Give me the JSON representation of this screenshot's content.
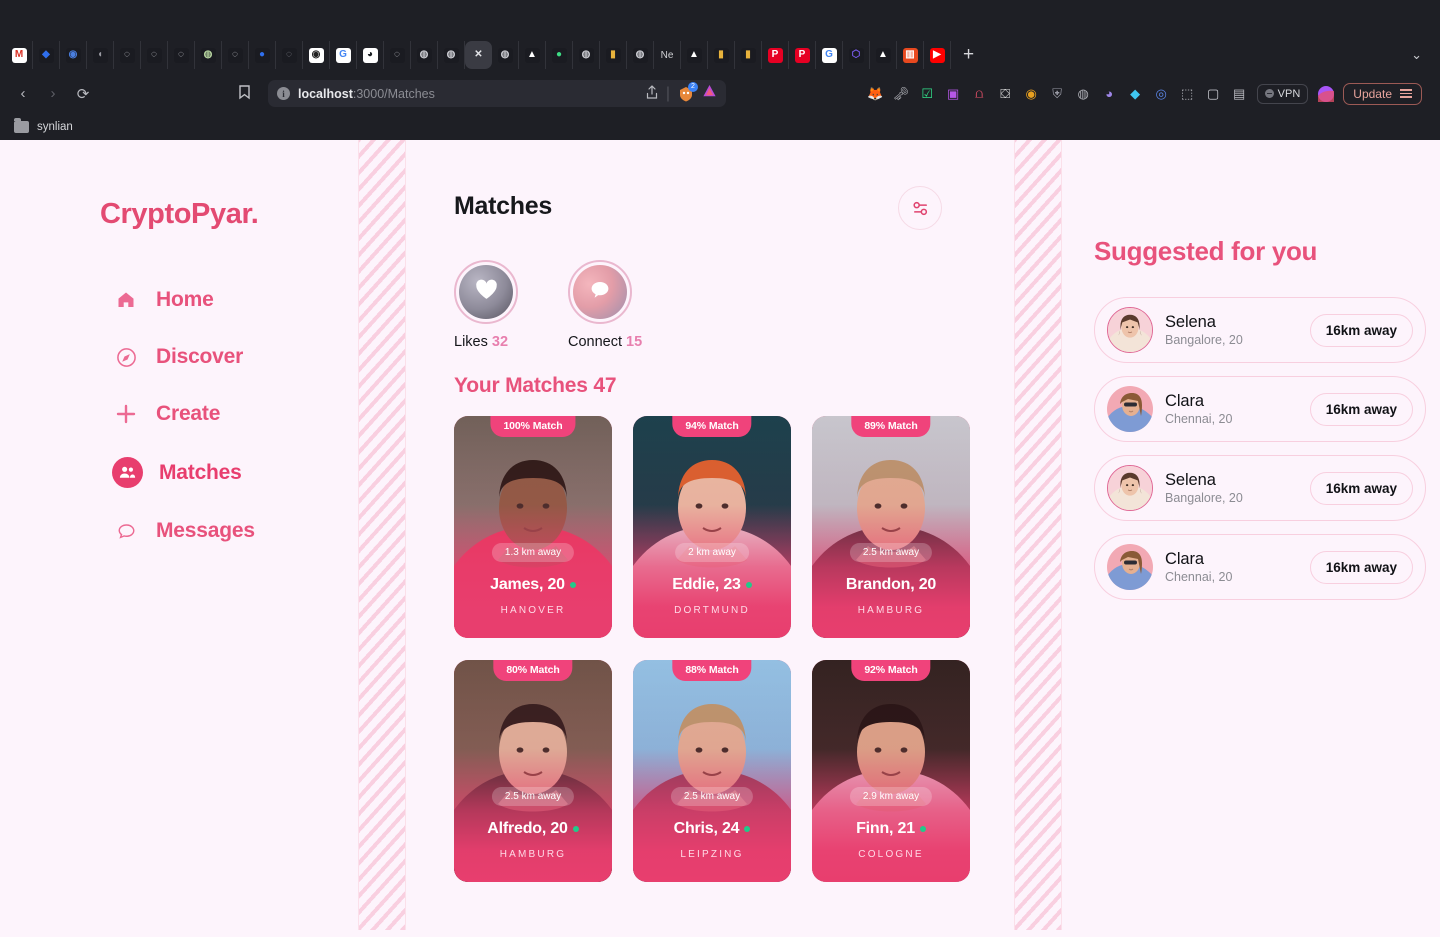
{
  "browser": {
    "url_host": "localhost",
    "url_rest": ":3000/Matches",
    "url_full": "localhost:3000/Matches",
    "info_glyph": "i",
    "back_glyph": "‹",
    "forward_glyph": "›",
    "reload_glyph": "⟳",
    "bookmark_glyph": "🔖",
    "share_glyph": "↥",
    "separator_glyph": "|",
    "ext_badge_count": "2",
    "new_tab_glyph": "+",
    "tab_overflow_glyph": "⌄",
    "vpn_label": "VPN",
    "update_label": "Update",
    "bookmark_folder": "synlian",
    "tabs": [
      {
        "name": "gmail-tab",
        "letter": "M",
        "bg": "#ffffff",
        "fg": "#d93025"
      },
      {
        "name": "blue-diamond-tab",
        "letter": "◆",
        "bg": "#1a1b21",
        "fg": "#2f6fed"
      },
      {
        "name": "ring-tab-1",
        "letter": "◉",
        "bg": "#1a1b21",
        "fg": "#4a7fe0"
      },
      {
        "name": "ghost-tab",
        "letter": "◖",
        "bg": "#1a1b21",
        "fg": "#9a9aa2"
      },
      {
        "name": "ring-tab-2",
        "letter": "◌",
        "bg": "#1a1b21",
        "fg": "#cfd0d6"
      },
      {
        "name": "ring-tab-3",
        "letter": "◌",
        "bg": "#1a1b21",
        "fg": "#cfd0d6"
      },
      {
        "name": "ring-tab-4",
        "letter": "◌",
        "bg": "#1a1b21",
        "fg": "#cfd0d6"
      },
      {
        "name": "globe-tab-1",
        "letter": "◍",
        "bg": "#1a1b21",
        "fg": "#b6d4a0"
      },
      {
        "name": "ring-tab-5",
        "letter": "◌",
        "bg": "#1a1b21",
        "fg": "#cfd0d6"
      },
      {
        "name": "blue-circle-tab",
        "letter": "●",
        "bg": "#1a1b21",
        "fg": "#2f6fed"
      },
      {
        "name": "dashed-ring-tab",
        "letter": "◌",
        "bg": "#1a1b21",
        "fg": "#8d8e96"
      },
      {
        "name": "fingerprint-tab",
        "letter": "◉",
        "bg": "#ffffff",
        "fg": "#222222"
      },
      {
        "name": "google-tab-1",
        "letter": "G",
        "bg": "#ffffff",
        "fg": "#4285f4"
      },
      {
        "name": "github-tab",
        "letter": "◕",
        "bg": "#ffffff",
        "fg": "#1b1f23"
      },
      {
        "name": "ring-tab-6",
        "letter": "◌",
        "bg": "#1a1b21",
        "fg": "#cfd0d6"
      },
      {
        "name": "globe-tab-2",
        "letter": "◍",
        "bg": "#1a1b21",
        "fg": "#c9cad0"
      },
      {
        "name": "globe-tab-3",
        "letter": "◍",
        "bg": "#1a1b21",
        "fg": "#c9cad0"
      },
      {
        "name": "active-close-tab",
        "letter": "✕",
        "bg": "transparent",
        "fg": "#e4e5e9",
        "active": true
      },
      {
        "name": "globe-tab-4",
        "letter": "◍",
        "bg": "#1a1b21",
        "fg": "#c9cad0"
      },
      {
        "name": "triangle-tab-1",
        "letter": "▲",
        "bg": "#1a1b21",
        "fg": "#ffffff"
      },
      {
        "name": "green-circle-tab",
        "letter": "●",
        "bg": "#1a1b21",
        "fg": "#3ddc84"
      },
      {
        "name": "globe-tab-5",
        "letter": "◍",
        "bg": "#1a1b21",
        "fg": "#c9cad0"
      },
      {
        "name": "colorful-tab-1",
        "letter": "▮",
        "bg": "#1a1b21",
        "fg": "#e8b33c"
      },
      {
        "name": "globe-tab-6",
        "letter": "◍",
        "bg": "#1a1b21",
        "fg": "#c9cad0"
      },
      {
        "name": "netflix-tab",
        "letter": "Ne",
        "bg": "transparent",
        "fg": "#cfd0d6",
        "text": true
      },
      {
        "name": "triangle-tab-2",
        "letter": "▲",
        "bg": "#1a1b21",
        "fg": "#ffffff"
      },
      {
        "name": "colorful-tab-2",
        "letter": "▮",
        "bg": "#1a1b21",
        "fg": "#e8b33c"
      },
      {
        "name": "colorful-tab-3",
        "letter": "▮",
        "bg": "#1a1b21",
        "fg": "#e8b33c"
      },
      {
        "name": "pinterest-tab-1",
        "letter": "P",
        "bg": "#e60023",
        "fg": "#ffffff"
      },
      {
        "name": "pinterest-tab-2",
        "letter": "P",
        "bg": "#e60023",
        "fg": "#ffffff"
      },
      {
        "name": "google-tab-2",
        "letter": "G",
        "bg": "#ffffff",
        "fg": "#4285f4"
      },
      {
        "name": "purple-ring-tab",
        "letter": "⬡",
        "bg": "#1a1b21",
        "fg": "#7b5cf0"
      },
      {
        "name": "triangle-tab-3",
        "letter": "▲",
        "bg": "#1a1b21",
        "fg": "#ffffff"
      },
      {
        "name": "orange-tab",
        "letter": "▥",
        "bg": "#e8491f",
        "fg": "#ffffff"
      },
      {
        "name": "youtube-tab",
        "letter": "▶",
        "bg": "#ff0000",
        "fg": "#ffffff"
      }
    ],
    "toolbar_icons": [
      {
        "name": "metamask-icon",
        "glyph": "🦊",
        "color": "#e8883a"
      },
      {
        "name": "keeper-icon",
        "glyph": "🗝",
        "color": "#b9bac0"
      },
      {
        "name": "checkmark-green-icon",
        "glyph": "☑",
        "color": "#31e08a"
      },
      {
        "name": "purple-square-icon",
        "glyph": "▣",
        "color": "#b657e8"
      },
      {
        "name": "people-red-icon",
        "glyph": "⩍",
        "color": "#e8506a"
      },
      {
        "name": "letterboxd-icon",
        "glyph": "⛋",
        "color": "#f0f0f0"
      },
      {
        "name": "bee-icon",
        "glyph": "◉",
        "color": "#e8a020"
      },
      {
        "name": "shield-icon",
        "glyph": "⛨",
        "color": "#9a9ba6"
      },
      {
        "name": "circle-gray-icon",
        "glyph": "◍",
        "color": "#b0b1b8"
      },
      {
        "name": "ghost-icon",
        "glyph": "◕",
        "color": "#9f86e8"
      },
      {
        "name": "diamond-blue-icon",
        "glyph": "◆",
        "color": "#3fc6f0"
      },
      {
        "name": "ring-blue-icon",
        "glyph": "◎",
        "color": "#5b86e8"
      },
      {
        "name": "puzzle-icon",
        "glyph": "⬚",
        "color": "#b9bac0"
      },
      {
        "name": "sidebar-icon",
        "glyph": "▢",
        "color": "#c9cad0"
      },
      {
        "name": "wallet-icon",
        "glyph": "▤",
        "color": "#b9bac0"
      }
    ]
  },
  "app": {
    "brand": "CryptoPyar.",
    "nav": [
      {
        "name": "home",
        "label": "Home",
        "icon": "home-icon",
        "glyph": "⌂",
        "active": false
      },
      {
        "name": "discover",
        "label": "Discover",
        "icon": "compass-icon",
        "glyph": "◍",
        "active": false
      },
      {
        "name": "create",
        "label": "Create",
        "icon": "plus-icon",
        "glyph": "+",
        "active": false
      },
      {
        "name": "matches",
        "label": "Matches",
        "icon": "people-icon",
        "glyph": "",
        "active": true
      },
      {
        "name": "messages",
        "label": "Messages",
        "icon": "chat-bubble-icon",
        "glyph": "",
        "active": false
      }
    ]
  },
  "main": {
    "title": "Matches",
    "filter_icon": "sliders-icon",
    "stats": [
      {
        "name": "likes",
        "label": "Likes",
        "count": "32",
        "icon": "heart-icon",
        "glyph": "♥"
      },
      {
        "name": "connect",
        "label": "Connect",
        "count": "15",
        "icon": "chat-icon",
        "glyph": ""
      }
    ],
    "your_matches_label": "Your Matches 47",
    "matches": [
      {
        "name": "James",
        "age": "20",
        "label": "James, 20",
        "match": "100% Match",
        "distance": "1.3 km away",
        "city": "HANOVER",
        "online": true
      },
      {
        "name": "Eddie",
        "age": "23",
        "label": "Eddie, 23",
        "match": "94% Match",
        "distance": "2 km away",
        "city": "DORTMUND",
        "online": true
      },
      {
        "name": "Brandon",
        "age": "20",
        "label": "Brandon, 20",
        "match": "89% Match",
        "distance": "2.5 km away",
        "city": "HAMBURG",
        "online": false
      },
      {
        "name": "Alfredo",
        "age": "20",
        "label": "Alfredo, 20",
        "match": "80% Match",
        "distance": "2.5 km away",
        "city": "HAMBURG",
        "online": true
      },
      {
        "name": "Chris",
        "age": "24",
        "label": "Chris, 24",
        "match": "88% Match",
        "distance": "2.5 km away",
        "city": "LEIPZING",
        "online": true
      },
      {
        "name": "Finn",
        "age": "21",
        "label": "Finn, 21",
        "match": "92% Match",
        "distance": "2.9 km away",
        "city": "COLOGNE",
        "online": true
      }
    ]
  },
  "suggested": {
    "title": "Suggested for you",
    "items": [
      {
        "name": "Selena",
        "sub": "Bangalore, 20",
        "distance": "16km away",
        "ring": true
      },
      {
        "name": "Clara",
        "sub": "Chennai, 20",
        "distance": "16km away",
        "ring": false
      },
      {
        "name": "Selena",
        "sub": "Bangalore, 20",
        "distance": "16km away",
        "ring": true
      },
      {
        "name": "Clara",
        "sub": "Chennai, 20",
        "distance": "16km away",
        "ring": false
      }
    ]
  },
  "colors": {
    "background": "#fdf4fc",
    "brand_pink": "#e8527c",
    "accent_pink": "#e83e6e",
    "badge_pink": "#f0437b",
    "online_green": "#22c98a",
    "chrome_dark": "#1e1f25"
  }
}
